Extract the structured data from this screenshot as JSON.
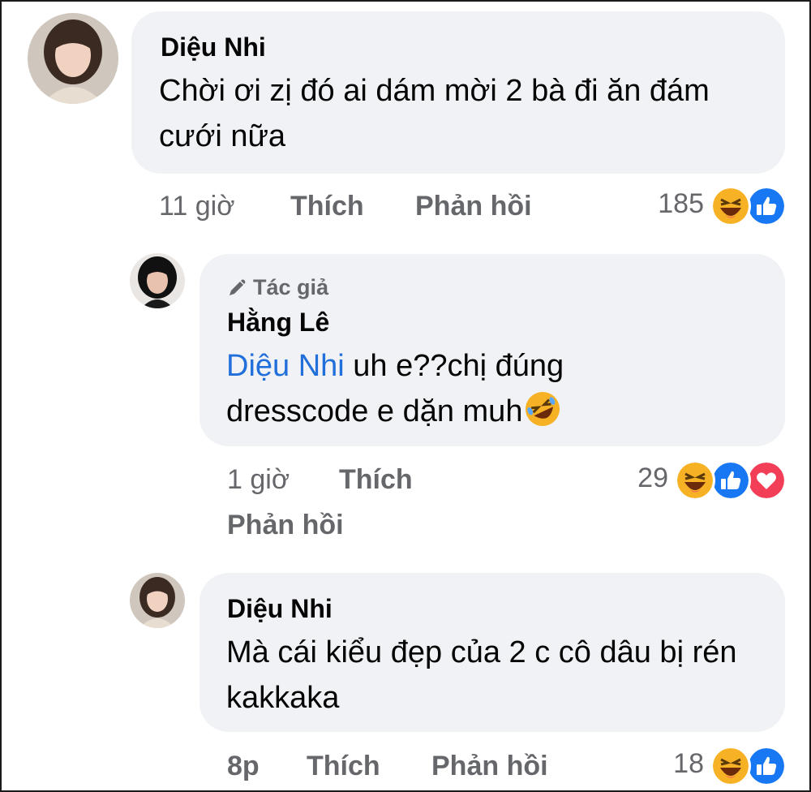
{
  "comments": [
    {
      "author": "Diệu Nhi",
      "text": "Chời ơi zị đó ai dám mời 2 bà đi ăn đám cưới nữa",
      "time": "11 giờ",
      "like": "Thích",
      "reply": "Phản hồi",
      "reaction_count": "185",
      "reactions": [
        "haha-icon",
        "like-icon"
      ]
    },
    {
      "badge": "Tác giả",
      "author": "Hằng Lê",
      "mention": "Diệu Nhi",
      "text": " uh e??chị đúng dresscode e dặn muh",
      "emoji": "rofl-emoji-icon",
      "time": "1 giờ",
      "like": "Thích",
      "reply": "Phản hồi",
      "reaction_count": "29",
      "reactions": [
        "haha-icon",
        "like-icon",
        "love-icon"
      ]
    },
    {
      "author": "Diệu Nhi",
      "text": "Mà cái kiểu đẹp của 2 c cô dâu bị rén kakkaka",
      "time": "8p",
      "like": "Thích",
      "reply": "Phản hồi",
      "reaction_count": "18",
      "reactions": [
        "haha-icon",
        "like-icon"
      ]
    }
  ],
  "colors": {
    "bubble": "#f0f2f5",
    "meta_text": "#65676b",
    "mention": "#216fdb",
    "like_blue": "#1877f2",
    "love_red": "#f33e58",
    "haha_yellow": "#f7b125"
  }
}
